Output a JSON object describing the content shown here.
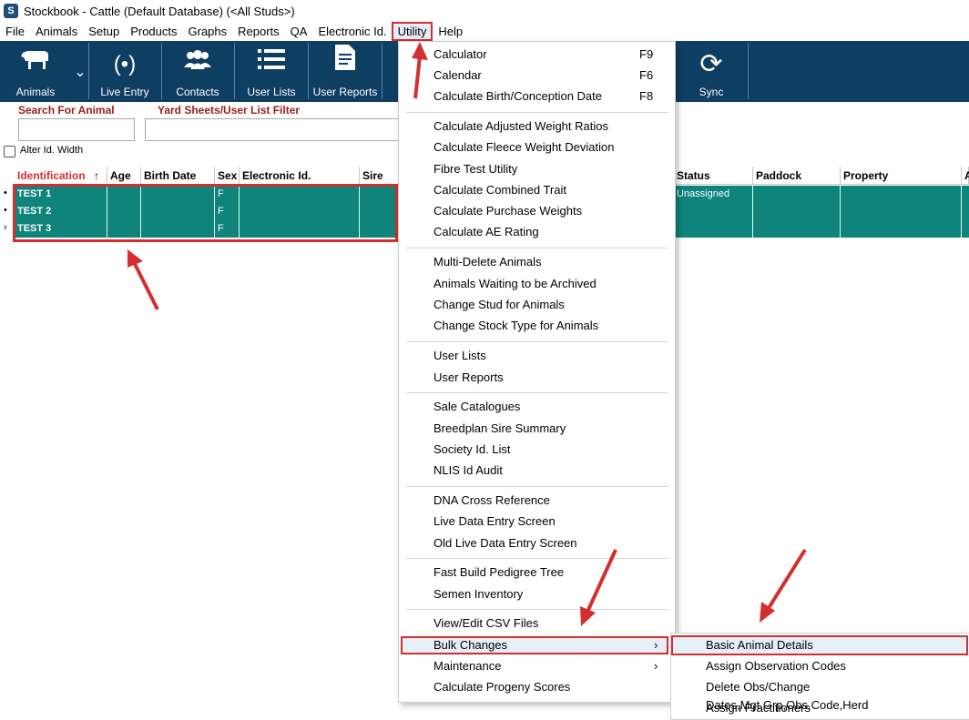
{
  "window": {
    "title": "Stockbook - Cattle (Default Database) (<All Studs>)",
    "icon": "S"
  },
  "menubar": [
    "File",
    "Animals",
    "Setup",
    "Products",
    "Graphs",
    "Reports",
    "QA",
    "Electronic Id.",
    "Utility",
    "Help"
  ],
  "toolbar": {
    "animals": "Animals",
    "live_entry": "Live Entry",
    "contacts": "Contacts",
    "user_lists": "User Lists",
    "user_reports": "User Reports",
    "sync": "Sync"
  },
  "filters": {
    "search_label": "Search For Animal",
    "yard_label": "Yard Sheets/User List Filter",
    "alter_label": "Alter Id. Width"
  },
  "grid": {
    "columns_left": [
      "Identification",
      "Age",
      "Birth Date",
      "Sex",
      "Electronic Id.",
      "Sire"
    ],
    "columns_right": [
      "Status",
      "Paddock",
      "Property",
      "A"
    ],
    "sort_indicator": "↑",
    "rows": [
      {
        "id": "TEST 1",
        "sex": "F",
        "status": "Unassigned"
      },
      {
        "id": "TEST 2",
        "sex": "F",
        "status": ""
      },
      {
        "id": "TEST 3",
        "sex": "F",
        "status": ""
      }
    ]
  },
  "utility_menu": {
    "group1": [
      {
        "label": "Calculator",
        "shortcut": "F9"
      },
      {
        "label": "Calendar",
        "shortcut": "F6"
      },
      {
        "label": "Calculate Birth/Conception Date",
        "shortcut": "F8"
      }
    ],
    "group2": [
      "Calculate Adjusted Weight Ratios",
      "Calculate Fleece Weight Deviation",
      "Fibre Test Utility",
      "Calculate Combined Trait",
      "Calculate Purchase Weights",
      "Calculate AE Rating"
    ],
    "group3": [
      "Multi-Delete Animals",
      "Animals Waiting to be Archived",
      "Change Stud for Animals",
      "Change Stock Type for Animals"
    ],
    "group4": [
      "User Lists",
      "User Reports"
    ],
    "group5": [
      "Sale Catalogues",
      "Breedplan Sire Summary",
      "Society Id. List",
      "NLIS Id Audit"
    ],
    "group6": [
      "DNA Cross Reference",
      "Live Data Entry Screen",
      "Old Live Data Entry Screen"
    ],
    "group7": [
      "Fast Build Pedigree Tree",
      "Semen Inventory"
    ],
    "group8": [
      "View/Edit CSV Files",
      "Bulk Changes",
      "Maintenance",
      "Calculate Progeny Scores"
    ],
    "submenu_arrow": "›"
  },
  "bulk_submenu": [
    "Basic Animal Details",
    "Assign Observation Codes",
    "Delete Obs/Change Dates,Mgt.Grp,Obs.Code,Herd",
    "Assign Practitioners"
  ],
  "colors": {
    "accent_red": "#d32f2f",
    "toolbar": "#0f3e63",
    "row_teal": "#0e847a"
  }
}
